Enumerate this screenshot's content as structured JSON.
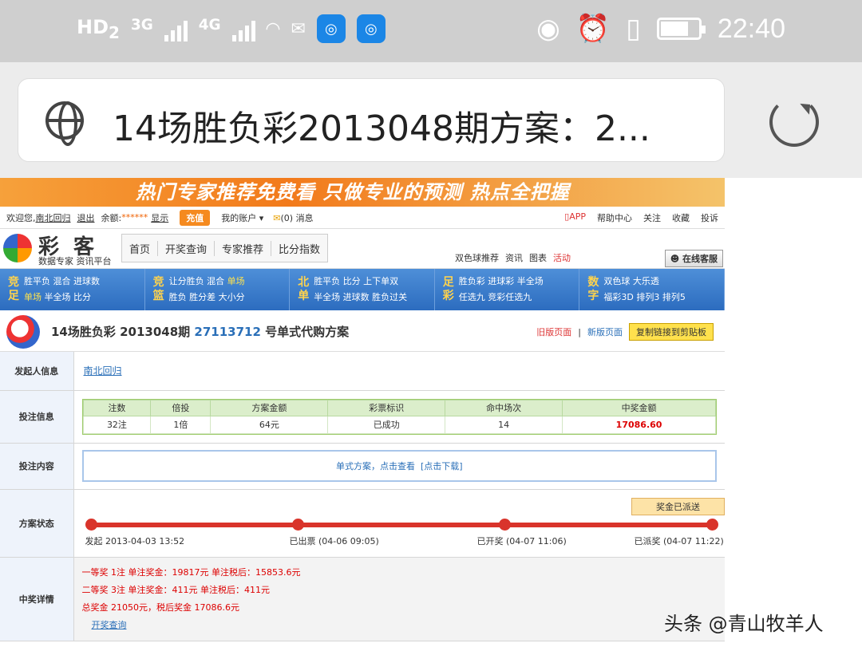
{
  "status_bar": {
    "hd": "HD",
    "hd_sub": "2",
    "net1": "3G",
    "net2": "4G",
    "time": "22:40",
    "icons": [
      "wifi-icon",
      "email-icon",
      "app-icon",
      "app-icon",
      "eye-icon",
      "alarm-icon",
      "vibrate-icon",
      "battery-icon"
    ]
  },
  "browser": {
    "url_title": "14场胜负彩2013048期方案：2..."
  },
  "banner": {
    "text": "热门专家推荐免费看 只做专业的预测 热点全把握"
  },
  "toplinks": {
    "welcome": "欢迎您,",
    "user": "南北回归",
    "logout": "退出",
    "balance_label": "余额:",
    "stars": "******",
    "show": "显示",
    "recharge": "充值",
    "account": "我的账户",
    "msg_count": "(0)",
    "msg": "消息",
    "right": [
      "APP",
      "帮助中心",
      "关注",
      "收藏",
      "投诉"
    ]
  },
  "header": {
    "logo_title": "彩客",
    "logo_sub": "数据专家 资讯平台",
    "mainnav": [
      "首页",
      "开奖查询",
      "专家推荐",
      "比分指数"
    ],
    "subnav": [
      "双色球推荐",
      "资讯",
      "图表",
      "活动"
    ],
    "kefu": "在线客服"
  },
  "bluenav": [
    {
      "tag": "竞足",
      "line1": "胜平负 混合 进球数",
      "line2_hl": "单场",
      "line2": " 半全场 比分"
    },
    {
      "tag": "竞篮",
      "line1": "让分胜负 混合 ",
      "line1_hl": "单场",
      "line2": "胜负 胜分差 大小分"
    },
    {
      "tag": "北单",
      "line1": "胜平负 比分 上下单双",
      "line2": "半全场 进球数 胜负过关"
    },
    {
      "tag": "足彩",
      "line1": "胜负彩 进球彩 半全场",
      "line2": "任选九 竞彩任选九"
    },
    {
      "tag": "数字",
      "line1": "双色球 大乐透",
      "line2": "福彩3D 排列3 排列5"
    }
  ],
  "title": {
    "prefix": "14场胜负彩 2013048期 ",
    "plan_id": "27113712",
    "suffix": " 号单式代购方案",
    "old": "旧版页面",
    "new": "新版页面",
    "copy": "复制链接到剪贴板"
  },
  "detail": {
    "sponsor_label": "发起人信息",
    "sponsor": "南北回归",
    "bet_label": "投注信息",
    "bet_headers": [
      "注数",
      "倍投",
      "方案金额",
      "彩票标识",
      "命中场次",
      "中奖金额"
    ],
    "bet_values": [
      "32注",
      "1倍",
      "64元",
      "已成功",
      "14",
      "17086.60"
    ],
    "content_label": "投注内容",
    "content_text": "单式方案，点击查看",
    "content_dl": "[点击下载]",
    "status_label": "方案状态",
    "sent": "奖金已派送",
    "steps": [
      "发起 2013-04-03 13:52",
      "已出票 (04-06 09:05)",
      "已开奖 (04-07 11:06)",
      "已派奖 (04-07 11:22)"
    ],
    "win_label": "中奖详情",
    "win_lines": [
      "一等奖 1注 单注奖金：19817元 单注税后：15853.6元",
      "二等奖 3注 单注奖金：411元 单注税后：411元",
      "总奖金 21050元，税后奖金 17086.6元"
    ],
    "draw_query": "开奖查询"
  },
  "watermark": "头条 @青山牧羊人"
}
